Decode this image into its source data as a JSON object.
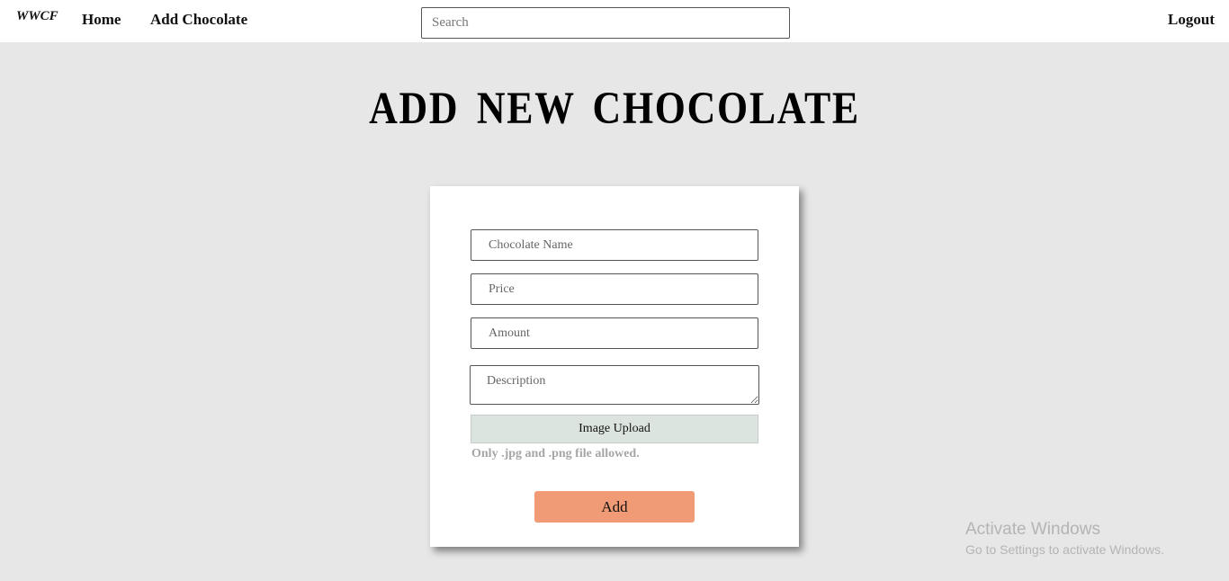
{
  "navbar": {
    "logo": "WWCF",
    "links": {
      "home": "Home",
      "add_chocolate": "Add Chocolate",
      "logout": "Logout"
    },
    "search_placeholder": "Search"
  },
  "page": {
    "title": "ADD NEW CHOCOLATE"
  },
  "form": {
    "name_placeholder": "Chocolate Name",
    "price_placeholder": "Price",
    "amount_placeholder": "Amount",
    "description_placeholder": "Description",
    "upload_label": "Image Upload",
    "upload_hint": "Only .jpg and .png file allowed.",
    "submit_label": "Add"
  },
  "os_watermark": {
    "title": "Activate Windows",
    "subtitle": "Go to Settings to activate Windows."
  },
  "colors": {
    "page_background": "#e7e7e7",
    "upload_background": "#dbe4de",
    "submit_background": "#f09b76",
    "hint_text": "#a6a6a6"
  }
}
